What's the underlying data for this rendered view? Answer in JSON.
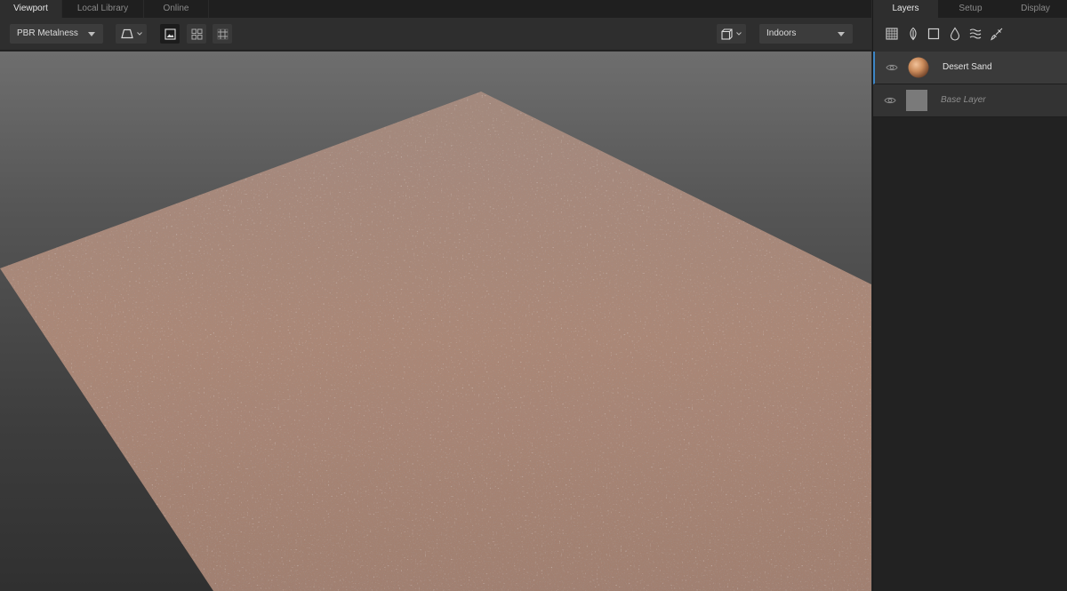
{
  "tabs": [
    {
      "label": "Viewport",
      "active": true
    },
    {
      "label": "Local Library",
      "active": false
    },
    {
      "label": "Online",
      "active": false
    }
  ],
  "toolbar": {
    "shader_mode": "PBR Metalness",
    "environment": "Indoors"
  },
  "right_panel": {
    "tabs": [
      {
        "label": "Layers",
        "active": true
      },
      {
        "label": "Setup",
        "active": false
      },
      {
        "label": "Display",
        "active": false
      }
    ],
    "tools": [
      "grid-icon",
      "leaf-icon",
      "square-icon",
      "drop-icon",
      "waves-icon",
      "brush-icon"
    ],
    "layers": [
      {
        "name": "Desert Sand",
        "selected": true
      },
      {
        "name": "Base Layer",
        "selected": false
      }
    ]
  },
  "colors": {
    "accent": "#3d86c6",
    "sand": "#a88675",
    "panel": "#222222",
    "toolbar": "#2e2e2e"
  }
}
